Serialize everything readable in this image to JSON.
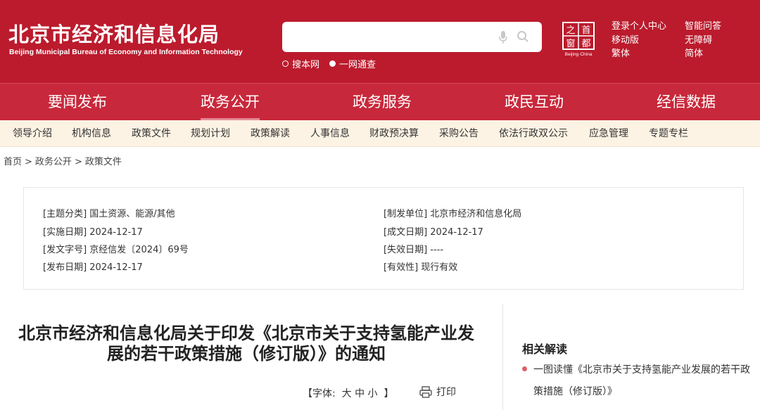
{
  "header": {
    "title": "北京市经济和信息化局",
    "subtitle": "Beijing Municipal Bureau of Economy and Information Technology",
    "search": {
      "placeholder": ""
    },
    "search_options": [
      "搜本网",
      "一网通查"
    ],
    "links_col1": [
      "登录个人中心",
      "移动版",
      "繁体"
    ],
    "links_col2": [
      "智能问答",
      "无障碍",
      "简体"
    ],
    "brand_color": "#bb1b2d"
  },
  "main_nav": [
    "要闻发布",
    "政务公开",
    "政务服务",
    "政民互动",
    "经信数据"
  ],
  "main_nav_active": "政务公开",
  "sub_nav": [
    "领导介绍",
    "机构信息",
    "政策文件",
    "规划计划",
    "政策解读",
    "人事信息",
    "财政预决算",
    "采购公告",
    "依法行政双公示",
    "应急管理",
    "专题专栏"
  ],
  "breadcrumb": [
    "首页",
    "政务公开",
    "政策文件"
  ],
  "metadata": {
    "left": [
      "[主题分类] 国土资源、能源/其他",
      "[实施日期] 2024-12-17",
      "[发文字号] 京经信发〔2024〕69号",
      "[发布日期] 2024-12-17"
    ],
    "right": [
      "[制发单位] 北京市经济和信息化局",
      "[成文日期] 2024-12-17",
      "[失效日期] ----",
      "[有效性] 现行有效"
    ]
  },
  "article": {
    "title_line1": "北京市经济和信息化局关于印发《北京市关于支持氢能产业发",
    "title_line2": "展的若干政策措施（修订版）》的通知",
    "font_label": "【字体:",
    "font_large": "大",
    "font_medium": "中",
    "font_small": "小",
    "font_end": "】",
    "print_label": "打印"
  },
  "sidebar": {
    "title": "相关解读",
    "link_line1": "一图读懂《北京市关于支持氢能产业发展的若干政",
    "link_line2": "策措施（修订版）》"
  }
}
